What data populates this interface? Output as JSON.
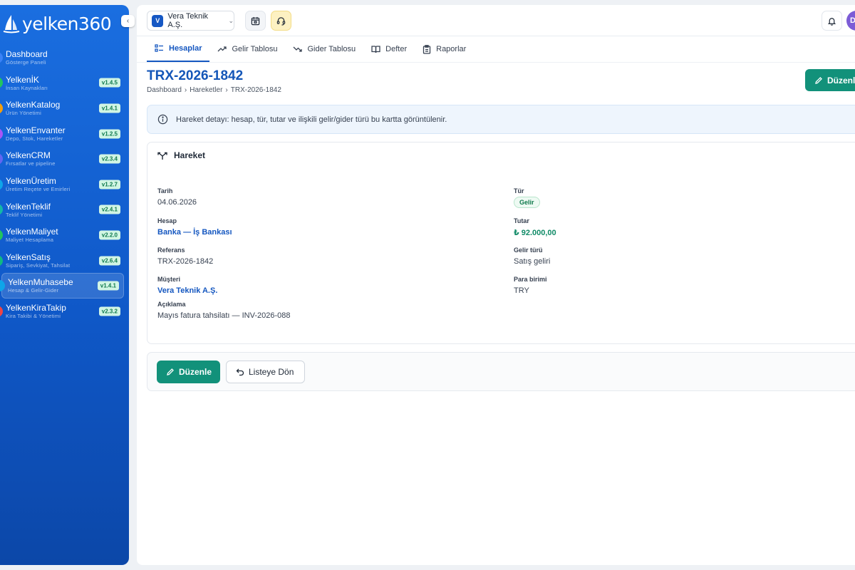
{
  "app": {
    "logo_text": "yelken360",
    "collapse_icon": "chevron-left-icon"
  },
  "sidebar": {
    "items": [
      {
        "title": "Dashboard",
        "subtitle": "Gösterge Paneli",
        "version": "",
        "dot_color": "#3b82f6",
        "active": false
      },
      {
        "title": "YelkenİK",
        "subtitle": "İnsan Kaynakları",
        "version": "v1.4.5",
        "dot_color": "#22c55e",
        "active": false
      },
      {
        "title": "YelkenKatalog",
        "subtitle": "Ürün Yönetimi",
        "version": "v1.4.1",
        "dot_color": "#f59e0b",
        "active": false
      },
      {
        "title": "YelkenEnvanter",
        "subtitle": "Depo, Stok, Hareketler",
        "version": "v1.2.5",
        "dot_color": "#a855f7",
        "active": false
      },
      {
        "title": "YelkenCRM",
        "subtitle": "Fırsatlar ve pipeline",
        "version": "v2.3.4",
        "dot_color": "#6366f1",
        "active": false
      },
      {
        "title": "YelkenÜretim",
        "subtitle": "Üretim Reçete ve Emirleri",
        "version": "v1.2.7",
        "dot_color": "#0ea5e9",
        "active": false
      },
      {
        "title": "YelkenTeklif",
        "subtitle": "Teklif Yönetimi",
        "version": "v2.4.1",
        "dot_color": "#14b8a6",
        "active": false
      },
      {
        "title": "YelkenMaliyet",
        "subtitle": "Maliyet Hesaplama",
        "version": "v2.2.0",
        "dot_color": "#22c55e",
        "active": false
      },
      {
        "title": "YelkenSatış",
        "subtitle": "Sipariş, Sevkiyat, Tahsilat",
        "version": "v2.6.4",
        "dot_color": "#10b981",
        "active": false
      },
      {
        "title": "YelkenMuhasebe",
        "subtitle": "Hesap & Gelir-Gider",
        "version": "v1.4.1",
        "dot_color": "#0ea5e9",
        "active": true
      },
      {
        "title": "YelkenKiraTakip",
        "subtitle": "Kira Takibi & Yönetimi",
        "version": "v2.3.2",
        "dot_color": "#ef4444",
        "active": false
      }
    ]
  },
  "topbar": {
    "company_initial": "V",
    "company_name": "Vera Teknik A.Ş.",
    "user_initial": "D"
  },
  "tabs": [
    {
      "label": "Hesaplar",
      "icon": "list-icon",
      "active": true
    },
    {
      "label": "Gelir Tablosu",
      "icon": "trend-up-icon",
      "active": false
    },
    {
      "label": "Gider Tablosu",
      "icon": "trend-down-icon",
      "active": false
    },
    {
      "label": "Defter",
      "icon": "book-icon",
      "active": false
    },
    {
      "label": "Raporlar",
      "icon": "clipboard-icon",
      "active": false
    }
  ],
  "page": {
    "title": "TRX-2026-1842",
    "breadcrumb": [
      "Dashboard",
      "Hareketler",
      "TRX-2026-1842"
    ],
    "edit_label_top": "Düzenle"
  },
  "info": {
    "text": "Hareket detayı: hesap, tür, tutar ve ilişkili gelir/gider türü bu kartta görüntülenir."
  },
  "card": {
    "title": "Hareket",
    "fields": {
      "tarih": {
        "label": "Tarih",
        "value": "04.06.2026"
      },
      "tur": {
        "label": "Tür",
        "value": "Gelir"
      },
      "hesap": {
        "label": "Hesap",
        "value": "Banka — İş Bankası"
      },
      "tutar": {
        "label": "Tutar",
        "value": "₺ 92.000,00"
      },
      "referans": {
        "label": "Referans",
        "value": "TRX-2026-1842"
      },
      "gelir_turu": {
        "label": "Gelir türü",
        "value": "Satış geliri"
      },
      "musteri": {
        "label": "Müşteri",
        "value": "Vera Teknik A.Ş."
      },
      "para_birimi": {
        "label": "Para birimi",
        "value": "TRY"
      },
      "aciklama": {
        "label": "Açıklama",
        "value": "Mayıs fatura tahsilatı — INV-2026-088"
      }
    }
  },
  "actions": {
    "edit_label": "Düzenle",
    "back_label": "Listeye Dön"
  },
  "colors": {
    "primary": "#1557c0",
    "accent_green": "#12917a",
    "sidebar_blue": "#1a6ee0"
  }
}
